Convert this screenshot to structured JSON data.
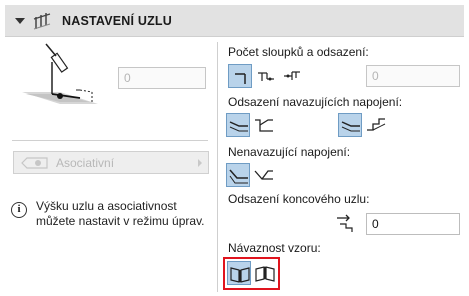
{
  "header": {
    "title": "NASTAVENÍ UZLU"
  },
  "left": {
    "node_height_value": "0",
    "association_label": "Asociativní",
    "info_text_line1": "Výšku uzlu a asociativnost",
    "info_text_line2": "můžete nastavit v režimu úprav."
  },
  "right": {
    "columns_label": "Počet sloupků a odsazení:",
    "columns_offset_value": "0",
    "connecting_offset_label": "Odsazení navazujících napojení:",
    "nonconnecting_label": "Nenavazující napojení:",
    "end_node_label": "Odsazení koncového uzlu:",
    "end_node_value": "0",
    "pattern_label": "Návaznost vzoru:"
  },
  "colors": {
    "selected_bg": "#b9d3ea",
    "selected_border": "#6f9cc4",
    "highlight": "#e0141e",
    "header_bg": "#e2e2e2"
  }
}
